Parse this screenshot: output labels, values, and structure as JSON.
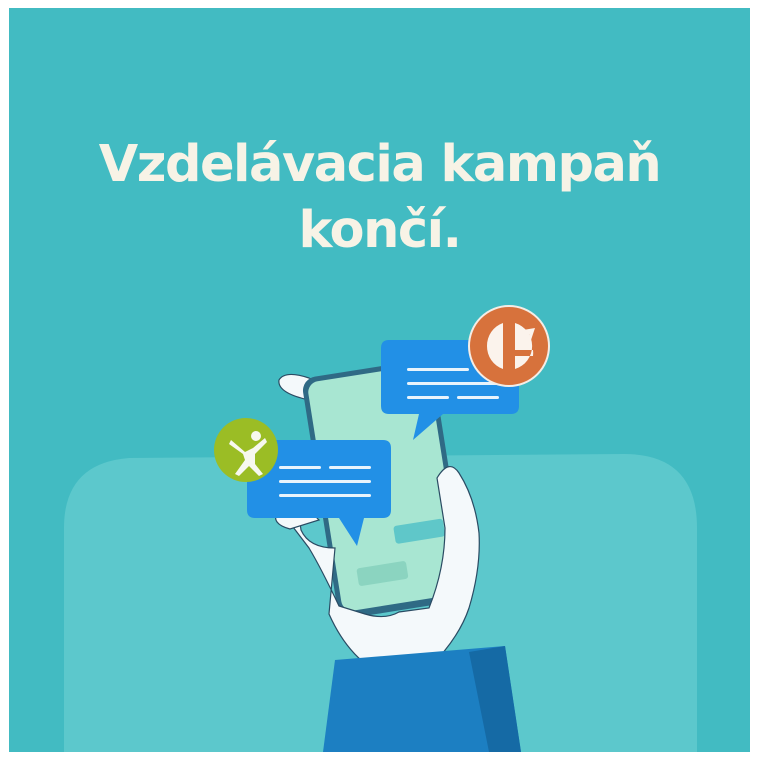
{
  "headline": {
    "line1": "Vzdelávacia kampaň",
    "line2": "končí."
  },
  "colors": {
    "background": "#42bbc2",
    "backdrop": "#5cc8cc",
    "headline": "#f7f3e6",
    "bubble": "#2290e6",
    "phone_screen": "#a8e6d2",
    "phone_frame": "#2f6a85",
    "hand": "#f4f9fb",
    "sleeve": "#1c7fc2",
    "badge_green": "#9bbd25",
    "badge_orange": "#d7723c"
  },
  "icons": {
    "left_badge": "person-figure-icon",
    "right_badge": "split-arrow-logo-icon"
  }
}
